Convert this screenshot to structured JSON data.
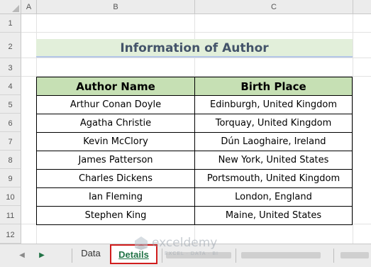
{
  "columns": [
    "A",
    "B",
    "C"
  ],
  "rows": [
    "1",
    "2",
    "3",
    "4",
    "5",
    "6",
    "7",
    "8",
    "9",
    "10",
    "11",
    "12"
  ],
  "title": "Information of Author",
  "table": {
    "headers": [
      "Author Name",
      "Birth Place"
    ],
    "rows": [
      [
        "Arthur Conan Doyle",
        "Edinburgh, United Kingdom"
      ],
      [
        "Agatha Christie",
        "Torquay, United Kingdom"
      ],
      [
        "Kevin McClory",
        "Dún Laoghaire, Ireland"
      ],
      [
        "James Patterson",
        "New York, United States"
      ],
      [
        "Charles Dickens",
        "Portsmouth, United Kingdom"
      ],
      [
        "Ian Fleming",
        "London, England"
      ],
      [
        "Stephen King",
        "Maine, United States"
      ]
    ]
  },
  "tabs": {
    "nav_prev_icon": "◀",
    "nav_next_icon": "▶",
    "items": [
      {
        "label": "Data",
        "active": false
      },
      {
        "label": "Details",
        "active": true
      }
    ]
  },
  "watermark": {
    "name": "exceldemy",
    "tagline": "EXCEL · DATA · BI"
  },
  "colors": {
    "title_fill": "#e2efda",
    "header_fill": "#c6e0b4",
    "active_tab_outline": "#d11d1d",
    "active_tab_text": "#217346"
  }
}
